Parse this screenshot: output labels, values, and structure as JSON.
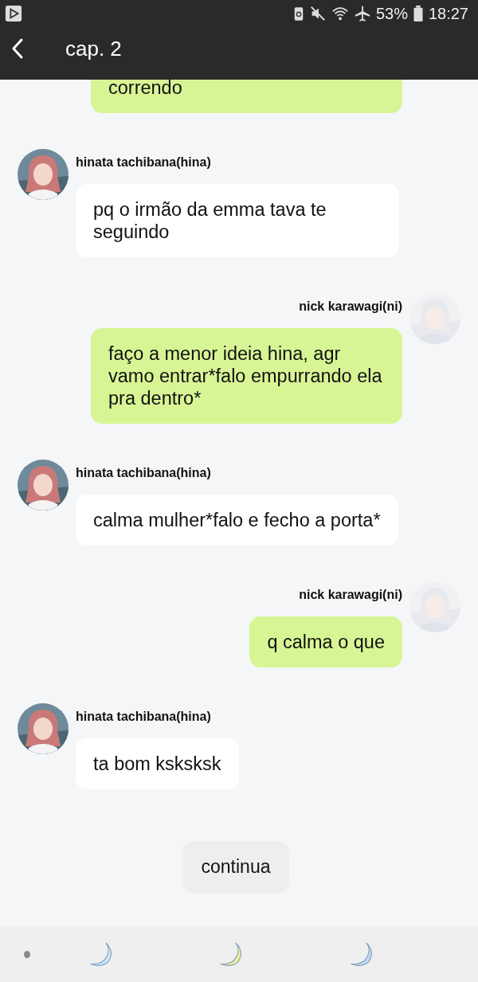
{
  "status_bar": {
    "battery_percent": "53%",
    "time": "18:27"
  },
  "header": {
    "title": "cap. 2"
  },
  "messages": [
    {
      "kind": "outgoing",
      "text": "correndo"
    },
    {
      "kind": "incoming",
      "name": "hinata tachibana(hina)",
      "text": "pq o irmão da emma tava te seguindo"
    },
    {
      "kind": "outgoing",
      "name": "nick karawagi(ni)",
      "text": "faço a menor ideia hina, agr vamo entrar*falo empurrando ela pra dentro*"
    },
    {
      "kind": "incoming",
      "name": "hinata tachibana(hina)",
      "text": "calma mulher*falo e fecho a porta*"
    },
    {
      "kind": "outgoing",
      "name": "nick karawagi(ni)",
      "text": "q calma o que"
    },
    {
      "kind": "incoming",
      "name": "hinata tachibana(hina)",
      "text": "ta bom ksksksk"
    }
  ],
  "continue_button": {
    "label": "continua"
  },
  "bottom_bar": {
    "items": [
      {
        "color": "#cfe8f8"
      },
      {
        "color": "#f3eca0"
      },
      {
        "color": "#c2d8f6"
      }
    ]
  }
}
